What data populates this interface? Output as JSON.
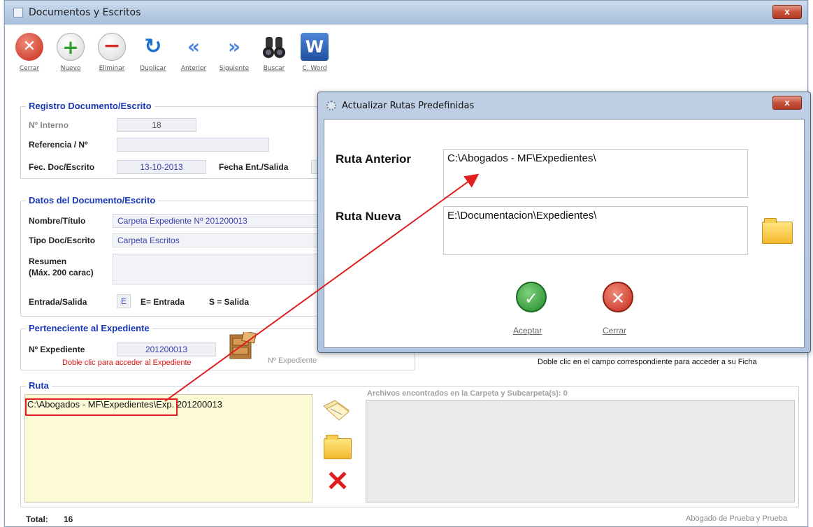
{
  "window": {
    "title": "Documentos y Escritos",
    "close": "x"
  },
  "toolbar": {
    "cerrar": "Cerrar",
    "nuevo": "Nuevo",
    "eliminar": "Eliminar",
    "duplicar": "Duplicar",
    "anterior": "Anterior",
    "siguiente": "Siguiente",
    "buscar": "Buscar",
    "cword": "C. Word",
    "word_glyph": "W"
  },
  "registro": {
    "title": "Registro Documento/Escrito",
    "interno_label": "Nº Interno",
    "interno_value": "18",
    "referencia_label": "Referencia / Nº",
    "referencia_value": "",
    "fecdoc_label": "Fec. Doc/Escrito",
    "fecdoc_value": "13-10-2013",
    "fechaent_label": "Fecha Ent./Salida"
  },
  "datos": {
    "title": "Datos del Documento/Escrito",
    "nombre_label": "Nombre/Título",
    "nombre_value": "Carpeta Expediente Nº 201200013",
    "tipo_label": "Tipo Doc/Escrito",
    "tipo_value": "Carpeta Escritos",
    "resumen_label_1": "Resumen",
    "resumen_label_2": "(Máx. 200 carac)",
    "entrada_label": "Entrada/Salida",
    "entrada_value": "E",
    "entrada_legend": "E= Entrada",
    "salida_legend": "S = Salida"
  },
  "expediente": {
    "title": "Perteneciente al Expediente",
    "numero_label": "Nº Expediente",
    "numero_value": "201200013",
    "hint": "Doble clic para acceder al Expediente",
    "icon_caption": "Nº Expediente"
  },
  "ficha_hint": "Doble clic en el campo correspondiente para acceder a su Ficha",
  "ruta": {
    "title": "Ruta",
    "value": "C:\\Abogados - MF\\Expedientes\\Exp. 201200013",
    "files_label": "Archivos encontrados en la Carpeta y Subcarpeta(s):  0"
  },
  "footer": {
    "total_label": "Total:",
    "total_value": "16",
    "user": "Abogado de Prueba y Prueba"
  },
  "dialog": {
    "title": "Actualizar Rutas Predefinidas",
    "close": "x",
    "ruta_anterior_label": "Ruta Anterior",
    "ruta_anterior_value": "C:\\Abogados - MF\\Expedientes\\",
    "ruta_nueva_label": "Ruta Nueva",
    "ruta_nueva_value": "E:\\Documentacion\\Expedientes\\",
    "aceptar": "Aceptar",
    "cerrar": "Cerrar"
  },
  "colors": {
    "accent_blue": "#1a37b8",
    "annotation_red": "#e02020",
    "ruta_bg": "#fdfbd6"
  }
}
